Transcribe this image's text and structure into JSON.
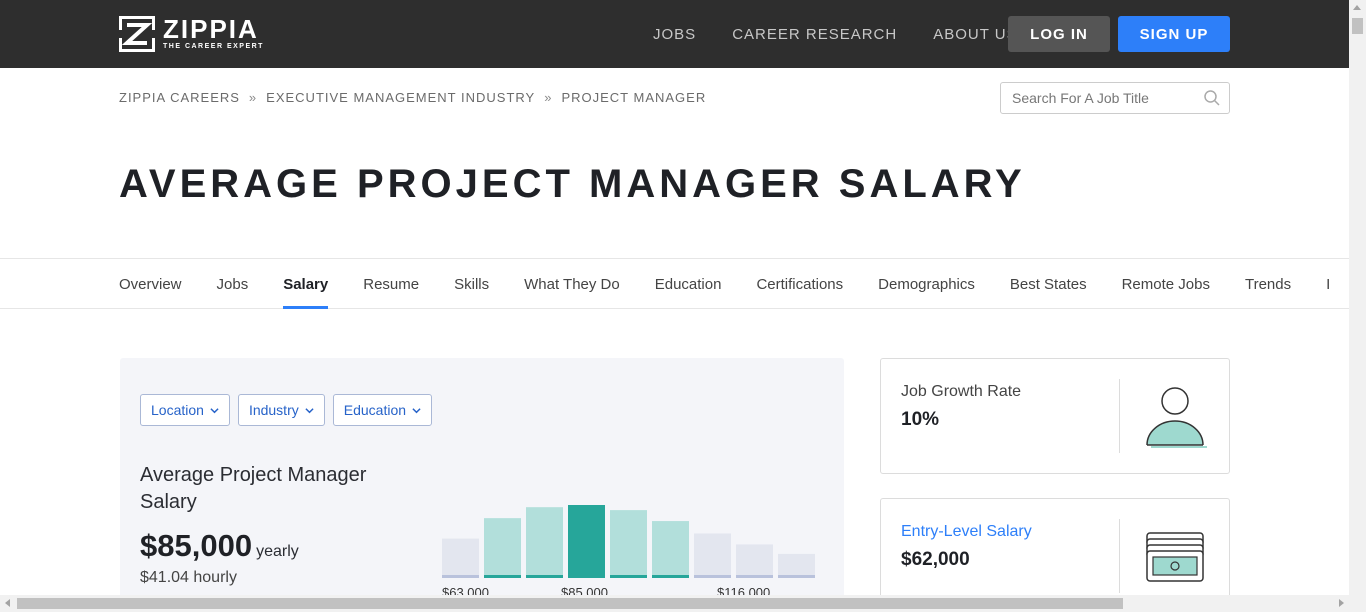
{
  "brand": {
    "name": "ZIPPIA",
    "tagline": "THE CAREER EXPERT"
  },
  "nav": {
    "links": [
      "JOBS",
      "CAREER RESEARCH",
      "ABOUT US"
    ],
    "login_label": "LOG IN",
    "signup_label": "SIGN UP"
  },
  "breadcrumb": [
    "ZIPPIA CAREERS",
    "EXECUTIVE MANAGEMENT INDUSTRY",
    "PROJECT MANAGER"
  ],
  "breadcrumb_sep": "»",
  "search": {
    "placeholder": "Search For A Job Title",
    "value": ""
  },
  "page_title": "AVERAGE PROJECT MANAGER SALARY",
  "tabs": {
    "items": [
      "Overview",
      "Jobs",
      "Salary",
      "Resume",
      "Skills",
      "What They Do",
      "Education",
      "Certifications",
      "Demographics",
      "Best States",
      "Remote Jobs",
      "Trends",
      "I"
    ],
    "active": "Salary"
  },
  "filters": [
    "Location",
    "Industry",
    "Education"
  ],
  "salary": {
    "title": "Average Project Manager Salary",
    "amount": "$85,000",
    "unit": "yearly",
    "hourly": "$41.04 hourly"
  },
  "chart_data": {
    "type": "bar",
    "values": [
      0.54,
      0.82,
      0.97,
      1.0,
      0.93,
      0.78,
      0.61,
      0.46,
      0.33
    ],
    "highlight_index": 3,
    "tick_labels": [
      "$63,000",
      "$85,000",
      "$116,000"
    ]
  },
  "stats": [
    {
      "label": "Job Growth Rate",
      "value": "10%",
      "icon": "person-icon",
      "link": false
    },
    {
      "label": "Entry-Level Salary",
      "value": "$62,000",
      "icon": "money-stack-icon",
      "link": true
    }
  ],
  "colors": {
    "topbar": "#2e2e2e",
    "accent": "#2d7ff9",
    "bar_teal": "#26a69a",
    "bar_light_teal": "#b2dfdb",
    "bar_gray": "#e3e6ef"
  }
}
